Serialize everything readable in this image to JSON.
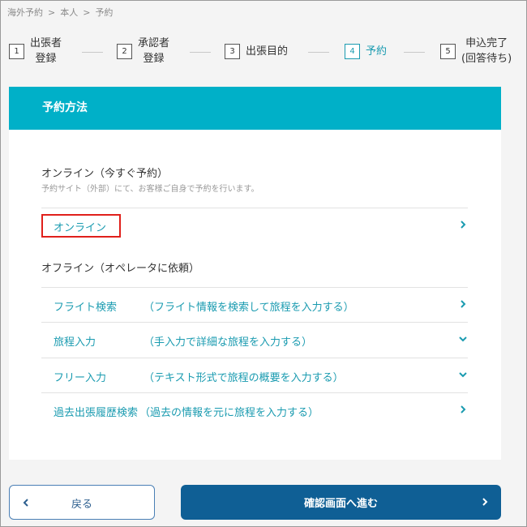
{
  "breadcrumb": [
    "海外予約",
    "本人",
    "予約"
  ],
  "breadcrumb_separator": ">",
  "steps": [
    {
      "num": "1",
      "label_line1": "出張者",
      "label_line2": "登録"
    },
    {
      "num": "2",
      "label_line1": "承認者",
      "label_line2": "登録"
    },
    {
      "num": "3",
      "label_line1": "出張目的",
      "label_line2": ""
    },
    {
      "num": "4",
      "label_line1": "予約",
      "label_line2": ""
    },
    {
      "num": "5",
      "label_line1": "申込完了",
      "label_line2": "(回答待ち)"
    }
  ],
  "active_step": 4,
  "card": {
    "header": "予約方法",
    "online_title": "オンライン（今すぐ予約）",
    "online_sub": "予約サイト（外部）にて、お客様ご自身で予約を行います。",
    "online_option": "オンライン",
    "offline_title": "オフライン（オペレータに依頼）",
    "offline_rows": [
      {
        "label": "フライト検索",
        "desc": "（フライト情報を検索して旅程を入力する）",
        "icon": "chevron-right-icon"
      },
      {
        "label": "旅程入力",
        "desc": "（手入力で詳細な旅程を入力する）",
        "icon": "chevron-down-icon"
      },
      {
        "label": "フリー入力",
        "desc": "（テキスト形式で旅程の概要を入力する）",
        "icon": "chevron-down-icon"
      },
      {
        "label": "過去出張履歴検索",
        "desc": "（過去の情報を元に旅程を入力する）",
        "icon": "chevron-right-icon"
      }
    ]
  },
  "buttons": {
    "back_label": "戻る",
    "next_label": "確認画面へ進む"
  },
  "colors": {
    "accent": "#00b0c8",
    "link": "#1a9bb0",
    "primary_button": "#0f5f95",
    "highlight_border": "#e0201b"
  }
}
